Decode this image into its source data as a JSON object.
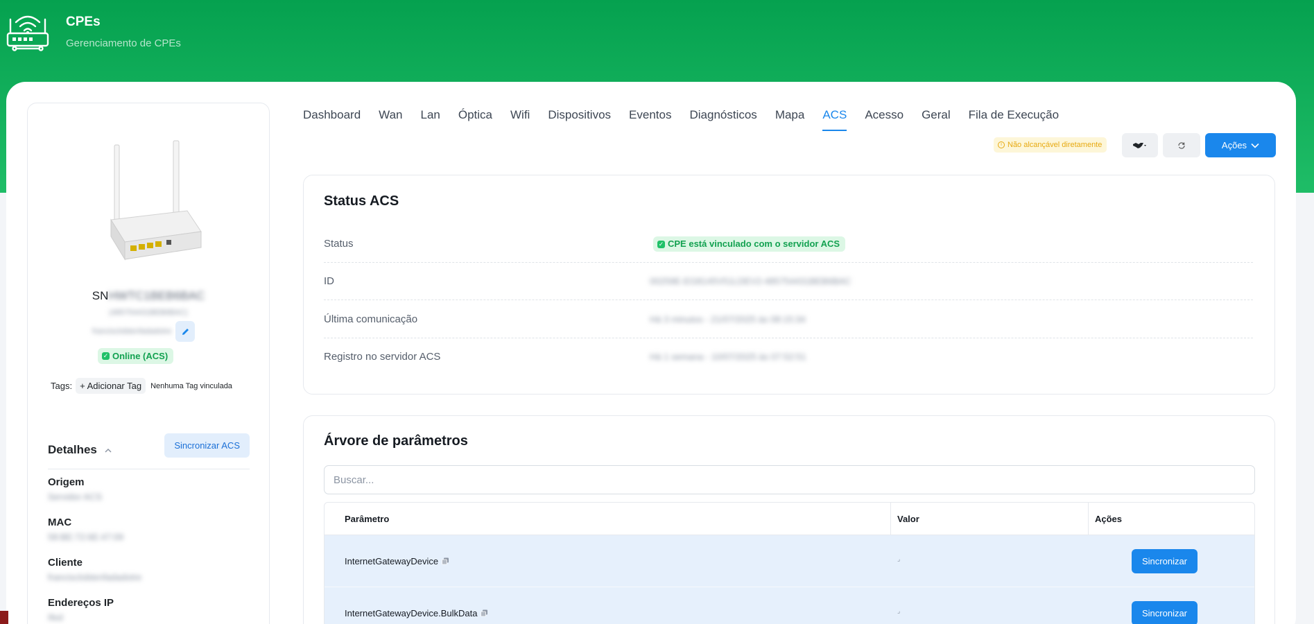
{
  "header": {
    "title": "CPEs",
    "subtitle": "Gerenciamento de CPEs",
    "logo_icon": "router-wifi-icon"
  },
  "device": {
    "sn_prefix": "SN",
    "sn_value": "HWTC1BEB6BAC",
    "sub_id": "(485754431BEB6BAC)",
    "owner": "francisclobtenfadadotre",
    "status_badge": "Online (ACS)",
    "tags_label": "Tags:",
    "add_tag": "+ Adicionar Tag",
    "no_tags": "Nenhuma Tag vinculada"
  },
  "details": {
    "title": "Detalhes",
    "sync_label": "Sincronizar ACS",
    "items": [
      {
        "label": "Origem",
        "value": "Servidor ACS"
      },
      {
        "label": "MAC",
        "value": "58:BE:72:6E:47:09"
      },
      {
        "label": "Cliente",
        "value": "francisclobtenfadadotre"
      },
      {
        "label": "Endereços IP",
        "value": "Ifed"
      }
    ]
  },
  "tabs": [
    {
      "label": "Dashboard",
      "active": false
    },
    {
      "label": "Wan",
      "active": false
    },
    {
      "label": "Lan",
      "active": false
    },
    {
      "label": "Óptica",
      "active": false
    },
    {
      "label": "Wifi",
      "active": false
    },
    {
      "label": "Dispositivos",
      "active": false
    },
    {
      "label": "Eventos",
      "active": false
    },
    {
      "label": "Diagnósticos",
      "active": false
    },
    {
      "label": "Mapa",
      "active": false
    },
    {
      "label": "ACS",
      "active": true
    },
    {
      "label": "Acesso",
      "active": false
    },
    {
      "label": "Geral",
      "active": false
    },
    {
      "label": "Fila de Execução",
      "active": false
    }
  ],
  "toolbar": {
    "warning": "Não alcançável diretamente",
    "actions_label": "Ações"
  },
  "status_acs": {
    "title": "Status ACS",
    "rows": [
      {
        "label": "Status",
        "value": "CPE está vinculado com o servidor ACS"
      },
      {
        "label": "ID",
        "value": "00259E-EG8145V51LDEV2-485754431BEB6BAC"
      },
      {
        "label": "Última comunicação",
        "value": "Há 3 minutos - 21/07/2025 às 08:15:34"
      },
      {
        "label": "Registro no servidor ACS",
        "value": "Há 1 semana - 10/07/2025 às 07:52:51"
      }
    ]
  },
  "param_tree": {
    "title": "Árvore de parâmetros",
    "search_placeholder": "Buscar...",
    "columns": [
      "Parâmetro",
      "Valor",
      "Ações"
    ],
    "rows": [
      {
        "name": "InternetGatewayDevice",
        "value": "⌟",
        "action": "Sincronizar"
      },
      {
        "name": "InternetGatewayDevice.BulkData",
        "value": "⌟",
        "action": "Sincronizar"
      }
    ]
  },
  "colors": {
    "header_green": "#05a14f",
    "accent_blue": "#1a87ec",
    "online_green": "#12a150",
    "warning_yellow": "#e7a911"
  }
}
